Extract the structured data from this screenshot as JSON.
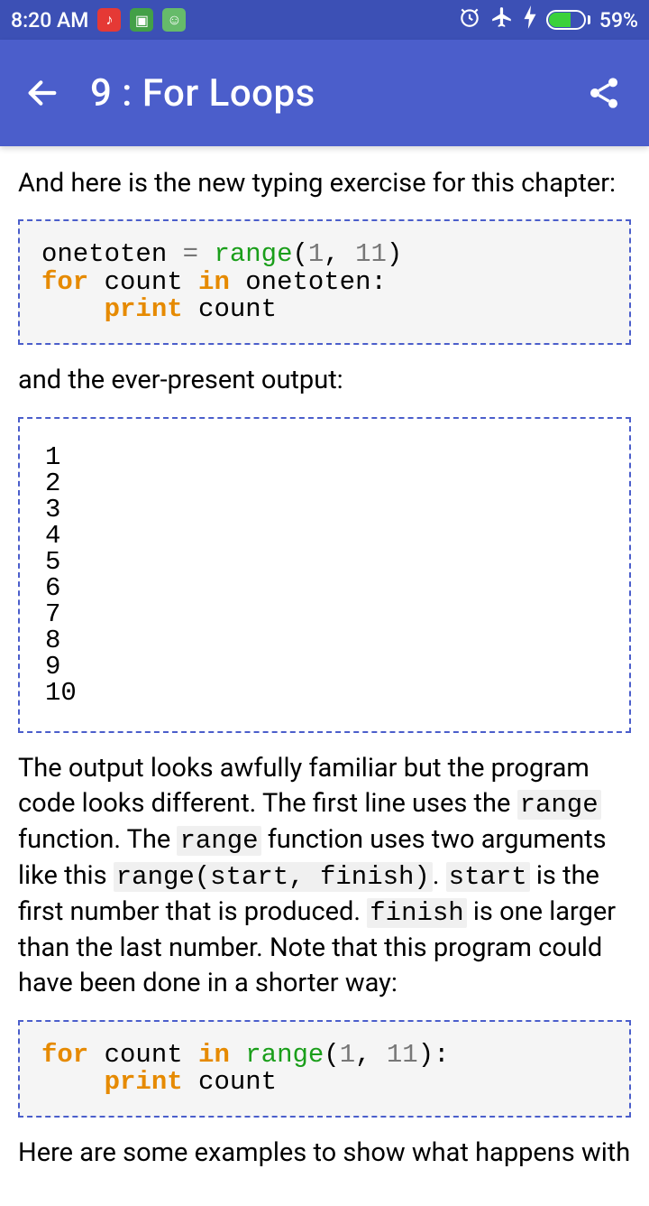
{
  "status": {
    "time": "8:20 AM",
    "battery_pct": "59%",
    "icons": {
      "i1": "♪",
      "i2": "▣",
      "i3": "☺",
      "alarm": "⏰",
      "plane": "✈",
      "bolt": "⚡"
    }
  },
  "appbar": {
    "title": "9 : For Loops"
  },
  "body": {
    "p1": "And here is the new typing exercise for this chapter:",
    "code1": {
      "l1a": "onetoten ",
      "l1b": "= ",
      "l1c": "range",
      "l1d": "(",
      "l1e": "1",
      "l1f": ", ",
      "l1g": "11",
      "l1h": ")",
      "l2a": "for",
      "l2b": " count ",
      "l2c": "in",
      "l2d": " onetoten:",
      "l3a": "    ",
      "l3b": "print",
      "l3c": " count"
    },
    "p2": "and the ever-present output:",
    "output": "1\n2\n3\n4\n5\n6\n7\n8\n9\n10",
    "p3_parts": {
      "t1": "The output looks awfully familiar but the program code looks different. The first line uses the ",
      "c1": "range",
      "t2": " function. The ",
      "c2": "range",
      "t3": " function uses two arguments like this ",
      "c3": "range(start, finish)",
      "t4": ". ",
      "c4": "start",
      "t5": " is the first number that is produced. ",
      "c5": "finish",
      "t6": " is one larger than the last number. Note that this program could have been done in a shorter way:"
    },
    "code2": {
      "l1a": "for",
      "l1b": " count ",
      "l1c": "in",
      "l1d": " ",
      "l1e": "range",
      "l1f": "(",
      "l1g": "1",
      "l1h": ", ",
      "l1i": "11",
      "l1j": "):",
      "l2a": "    ",
      "l2b": "print",
      "l2c": " count"
    },
    "p4": "Here are some examples to show what happens with"
  }
}
